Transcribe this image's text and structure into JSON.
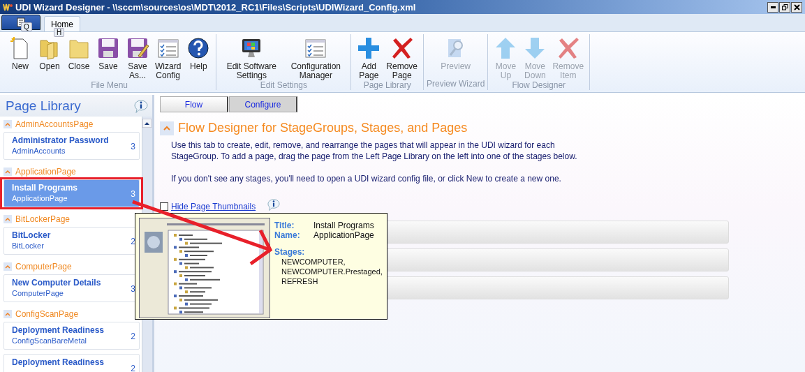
{
  "window": {
    "title": "UDI Wizard Designer - \\\\sccm\\sources\\os\\MDT\\2012_RC1\\Files\\Scripts\\UDIWizard_Config.xml"
  },
  "app_menu": {
    "key_tip": "Q"
  },
  "ribbon_tabs": [
    {
      "label": "Home",
      "key_tip": "H",
      "selected": true
    }
  ],
  "ribbon_groups": [
    {
      "label": "File Menu",
      "disabled": false,
      "buttons": [
        {
          "kind": "new",
          "label": "New"
        },
        {
          "kind": "open",
          "label": "Open"
        },
        {
          "kind": "close",
          "label": "Close"
        },
        {
          "kind": "save",
          "label": "Save"
        },
        {
          "kind": "saveas",
          "label": "Save As..."
        },
        {
          "kind": "checklist",
          "label": "Wizard Config"
        },
        {
          "kind": "help",
          "label": "Help"
        }
      ]
    },
    {
      "label": "Edit Settings",
      "disabled": false,
      "buttons": [
        {
          "kind": "monitor",
          "label": "Edit Software Settings"
        },
        {
          "kind": "checklist",
          "label": "Configuration Manager"
        }
      ]
    },
    {
      "label": "Page Library",
      "disabled": false,
      "buttons": [
        {
          "kind": "plus",
          "label": "Add Page"
        },
        {
          "kind": "x",
          "label": "Remove Page"
        }
      ]
    },
    {
      "label": "Preview Wizard",
      "disabled": true,
      "buttons": [
        {
          "kind": "preview",
          "label": "Preview"
        }
      ]
    },
    {
      "label": "Flow Designer",
      "disabled": true,
      "buttons": [
        {
          "kind": "up",
          "label": "Move Up"
        },
        {
          "kind": "down",
          "label": "Move Down"
        },
        {
          "kind": "x",
          "label": "Remove Item"
        }
      ]
    }
  ],
  "sidebar": {
    "title": "Page Library",
    "groups": [
      {
        "name": "AdminAccountsPage",
        "items": [
          {
            "title": "Administrator Password",
            "subtitle": "AdminAccounts",
            "count": "3",
            "selected": false
          }
        ]
      },
      {
        "name": "ApplicationPage",
        "items": [
          {
            "title": "Install Programs",
            "subtitle": "ApplicationPage",
            "count": "3",
            "selected": true
          }
        ]
      },
      {
        "name": "BitLockerPage",
        "items": [
          {
            "title": "BitLocker",
            "subtitle": "BitLocker",
            "count": "2",
            "selected": false
          }
        ]
      },
      {
        "name": "ComputerPage",
        "items": [
          {
            "title": "New Computer Details",
            "subtitle": "ComputerPage",
            "count": "3",
            "selected": false
          }
        ]
      },
      {
        "name": "ConfigScanPage",
        "items": [
          {
            "title": "Deployment Readiness",
            "subtitle": "ConfigScanBareMetal",
            "count": "2",
            "selected": false
          },
          {
            "title": "Deployment Readiness",
            "count": "2",
            "selected": false
          }
        ]
      }
    ]
  },
  "content_tabs": [
    {
      "label": "Flow",
      "selected": true
    },
    {
      "label": "Configure",
      "selected": false
    }
  ],
  "section": {
    "title": "Flow Designer for StageGroups, Stages, and Pages",
    "paragraphs": [
      "Use this tab to create, edit, remove, and rearrange the pages that will appear in the UDI wizard for each StageGroup. To add a page, drag the page from the Left Page Library on the left into one of the stages below.",
      "If you don't see any stages, you'll need to open a UDI wizard config file, or click New to create a new one."
    ]
  },
  "hide_thumbnails": {
    "label": "Hide Page Thumbnails",
    "checked": false
  },
  "tooltip": {
    "title_label": "Title:",
    "title": "Install Programs",
    "name_label": "Name:",
    "name": "ApplicationPage",
    "stages_label": "Stages:",
    "stages": [
      "NEWCOMPUTER,",
      "NEWCOMPUTER.Prestaged,",
      "REFRESH"
    ]
  }
}
